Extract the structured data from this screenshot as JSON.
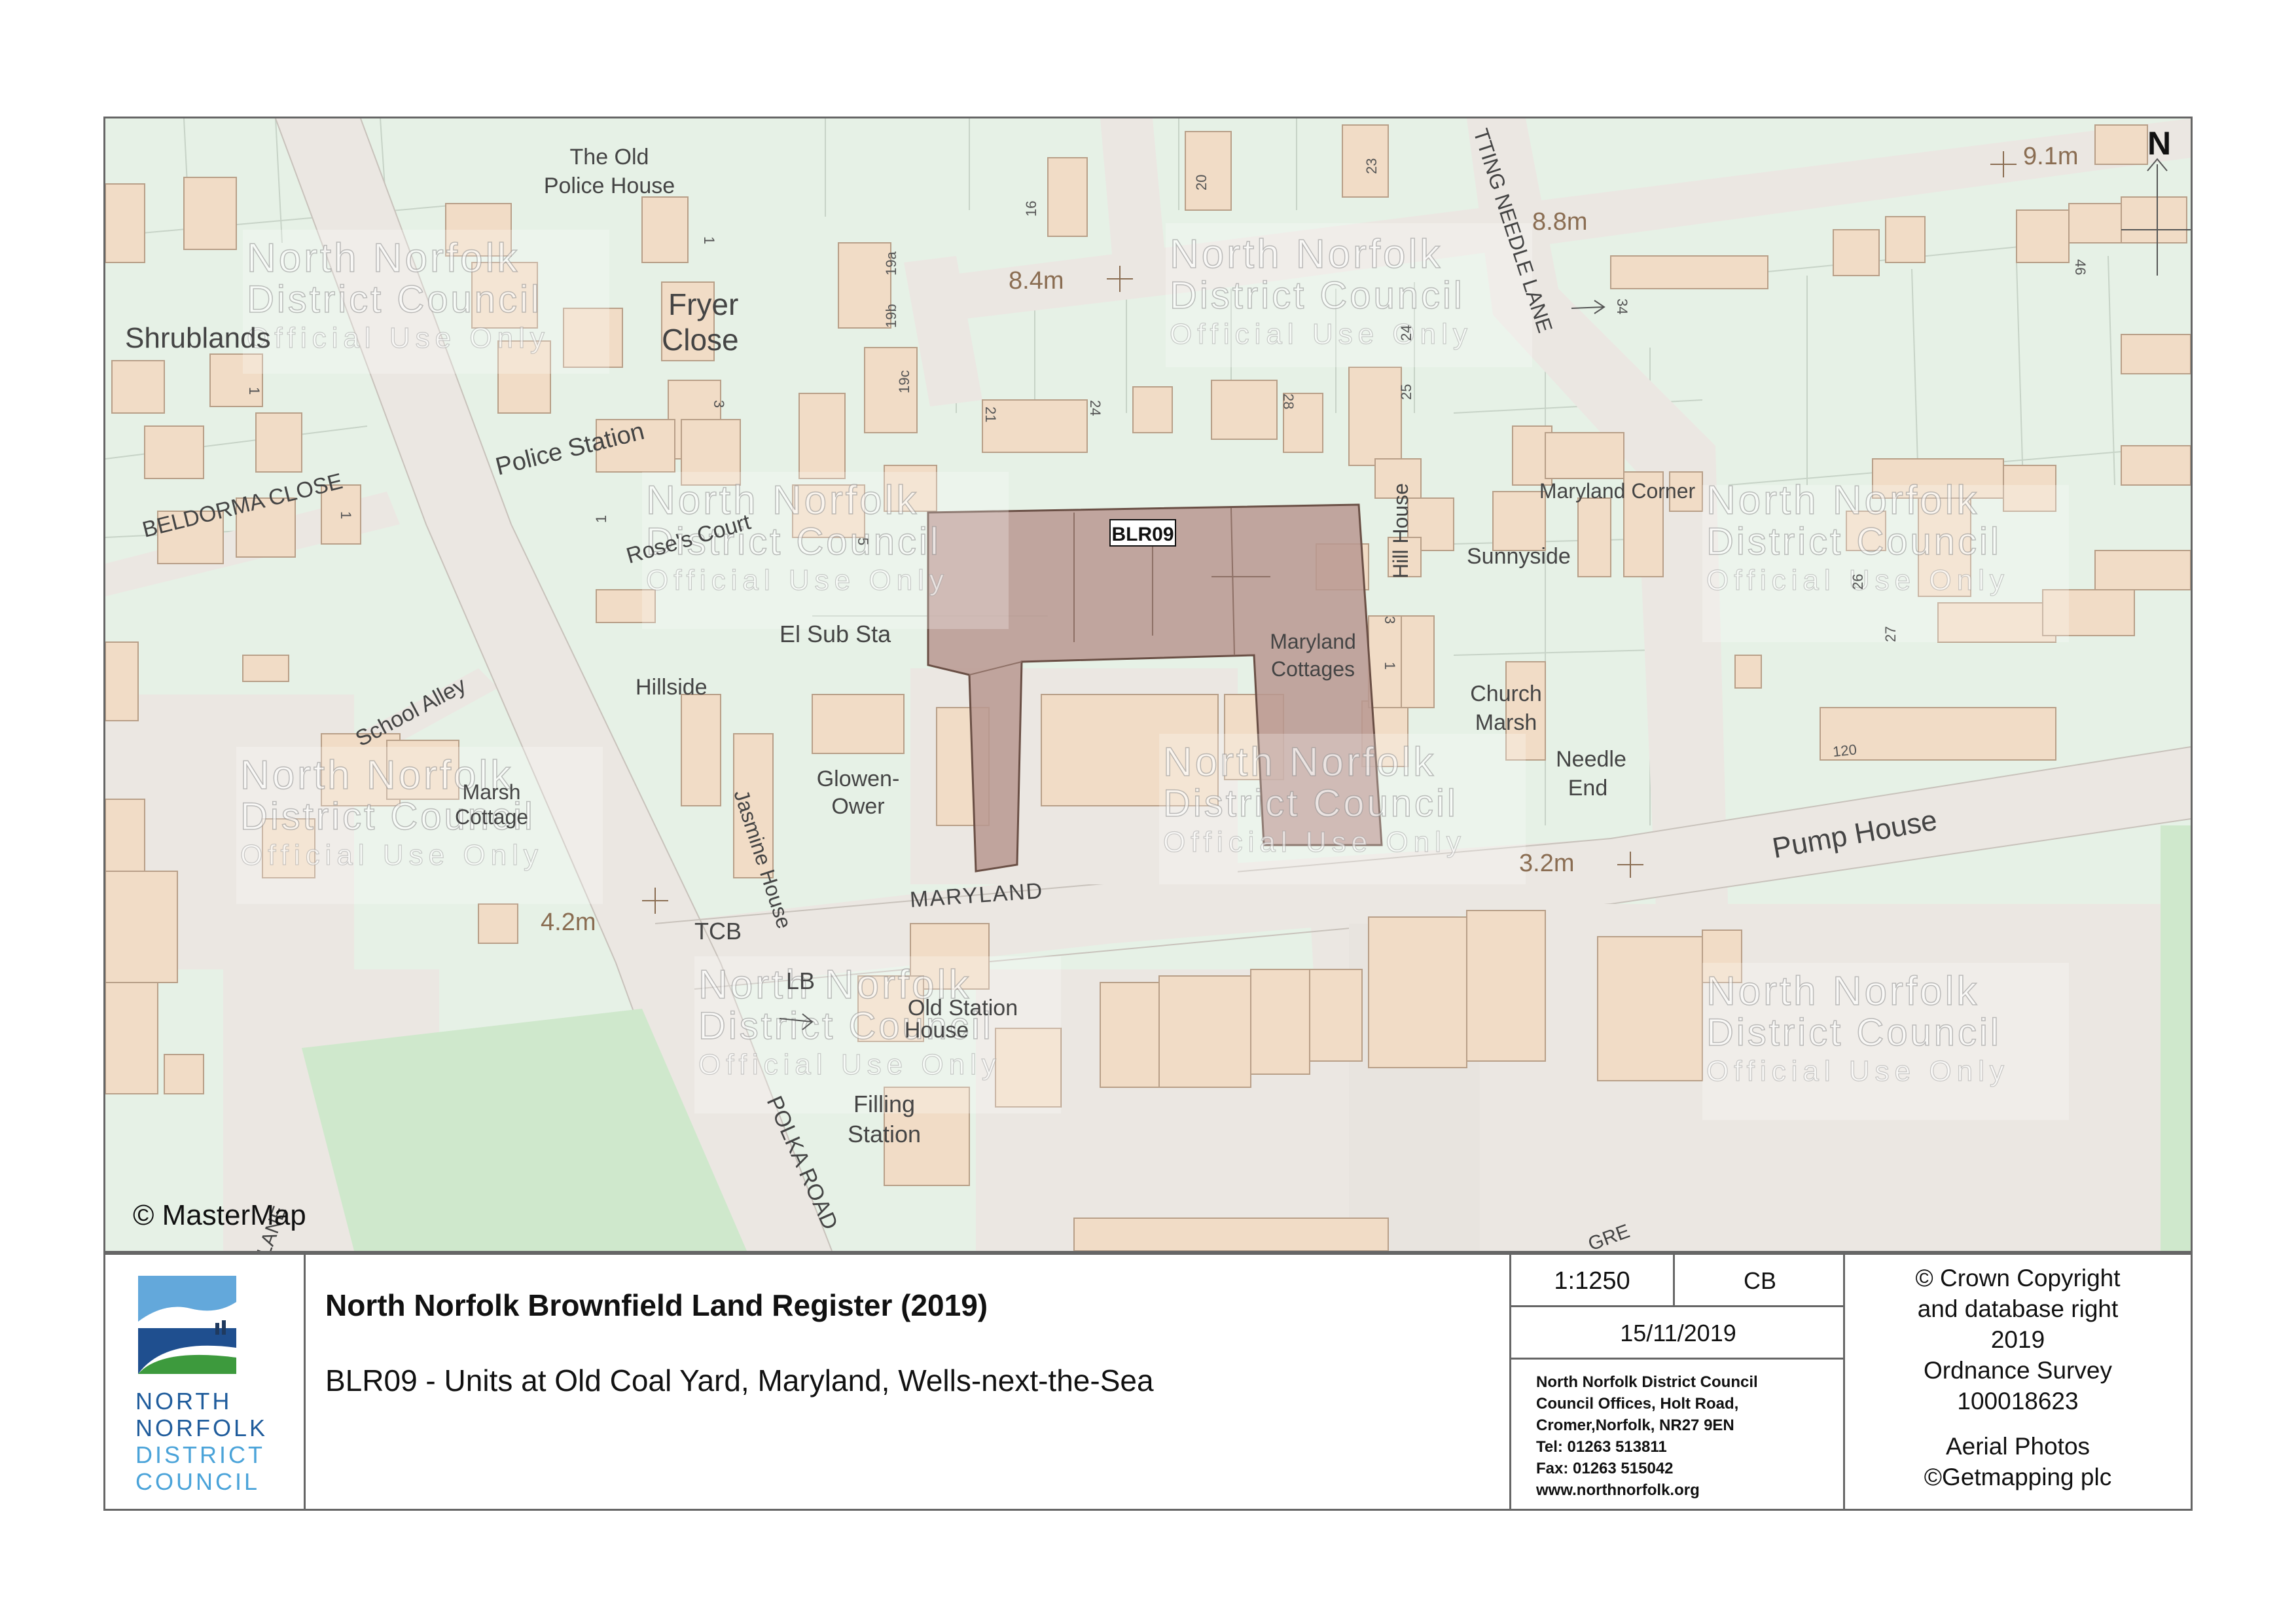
{
  "map": {
    "site_label": "BLR09",
    "street_labels": {
      "maryland": "MARYLAND",
      "beldorma_close": "BELDORMA CLOSE",
      "police_station": "Police Station",
      "school_alley": "School Alley",
      "polka_road": "POLKA ROAD",
      "pump_house": "Pump House",
      "rose_court": "Rose's Court",
      "needle_lane": "TTING NEEDLE LANE",
      "lane_fragment": "LANE",
      "gre_fragment": "GRE"
    },
    "place_labels": {
      "old_police_house_1": "The Old",
      "old_police_house_2": "Police House",
      "shrublands": "Shrublands",
      "fryer_close_1": "Fryer",
      "fryer_close_2": "Close",
      "el_sub_sta": "El Sub Sta",
      "hillside": "Hillside",
      "marsh_cottage_1": "Marsh",
      "marsh_cottage_2": "Cottage",
      "jasmine_house": "Jasmine House",
      "glowen_ower_1": "Glowen-",
      "glowen_ower_2": "Ower",
      "tcb": "TCB",
      "lb": "LB",
      "old_station_house_1": "Old Station",
      "old_station_house_2": "House",
      "filling_station_1": "Filling",
      "filling_station_2": "Station",
      "hill_house": "Hill House",
      "sunnyside": "Sunnyside",
      "maryland_corner": "Maryland Corner",
      "maryland_cottages_1": "Maryland",
      "maryland_cottages_2": "Cottages",
      "church_marsh_1": "Church",
      "church_marsh_2": "Marsh",
      "needle_end_1": "Needle",
      "needle_end_2": "End"
    },
    "spot_heights": {
      "h91": "9.1m",
      "h88": "8.8m",
      "h84": "8.4m",
      "h42": "4.2m",
      "h32": "3.2m"
    },
    "house_numbers": {
      "n1a": "1",
      "n3": "3",
      "n1b": "1",
      "n1c": "1",
      "n1d": "1",
      "n5": "5",
      "n16": "16",
      "n20": "20",
      "n23": "23",
      "n19a": "19a",
      "n19b": "19b",
      "n19c": "19c",
      "n21": "21",
      "n24": "24",
      "n28": "28",
      "n24b": "24",
      "n25": "25",
      "n34": "34",
      "n46": "46",
      "n3b": "3",
      "n1e": "1",
      "n26": "26",
      "n27": "27",
      "n120": "120"
    },
    "north_arrow": "N",
    "copyright_mark": "© MasterMap",
    "watermark": {
      "line1": "North Norfolk",
      "line2": "District Council",
      "line3": "Official Use Only"
    }
  },
  "title_block": {
    "logo": {
      "line1": "NORTH",
      "line2": "NORFOLK",
      "line3": "DISTRICT",
      "line4": "COUNCIL"
    },
    "title": "North Norfolk Brownfield Land Register (2019)",
    "subtitle": "BLR09 - Units at Old Coal Yard, Maryland, Wells-next-the-Sea",
    "scale": "1:1250",
    "initials": "CB",
    "date": "15/11/2019",
    "office": {
      "line1": "North Norfolk District Council",
      "line2": "Council Offices, Holt Road,",
      "line3": "Cromer,Norfolk, NR27 9EN",
      "line4": "Tel: 01263 513811",
      "line5": "Fax: 01263 515042",
      "line6": "www.northnorfolk.org"
    },
    "copyright": {
      "line1": "© Crown Copyright",
      "line2": "and database right",
      "line3": "2019",
      "line4": "Ordnance Survey",
      "line5": "100018623",
      "line6": "Aerial Photos",
      "line7": "©Getmapping plc"
    }
  },
  "colors": {
    "site_fill": "#b99890",
    "building_fill": "#f1dcc6",
    "ground_fill": "#e6f1e6",
    "road_fill": "#ebe7e2",
    "logo_blue": "#1f5c9c"
  }
}
